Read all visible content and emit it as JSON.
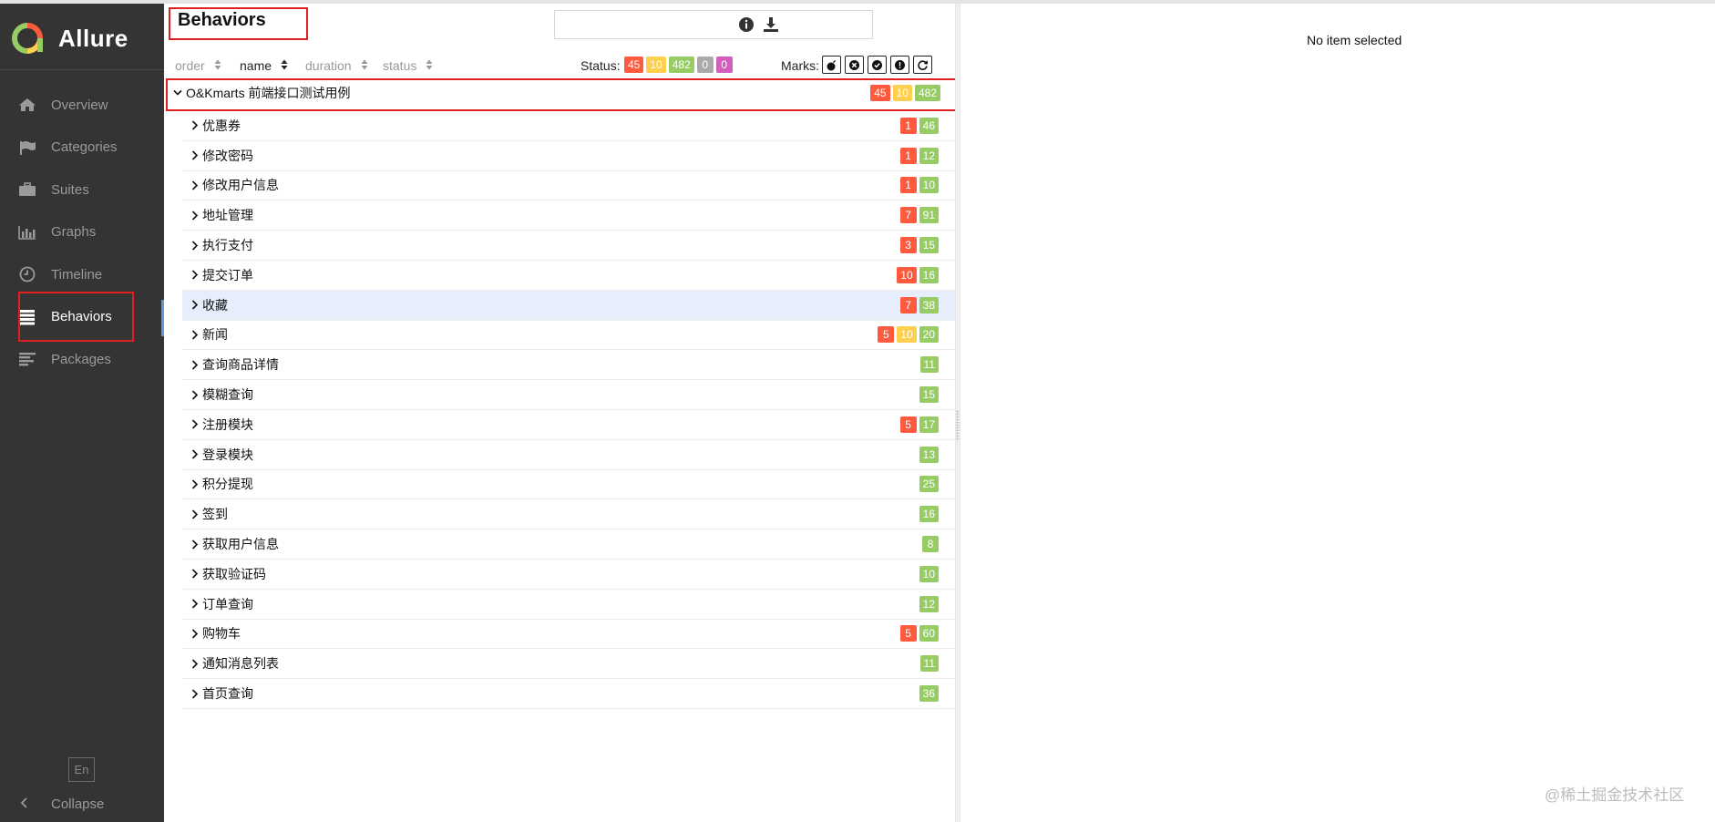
{
  "app": {
    "name": "Allure"
  },
  "sidebar": {
    "items": [
      {
        "label": "Overview",
        "icon": "home-icon"
      },
      {
        "label": "Categories",
        "icon": "flag-icon"
      },
      {
        "label": "Suites",
        "icon": "briefcase-icon"
      },
      {
        "label": "Graphs",
        "icon": "bar-chart-icon"
      },
      {
        "label": "Timeline",
        "icon": "clock-icon"
      },
      {
        "label": "Behaviors",
        "icon": "list-icon",
        "active": true
      },
      {
        "label": "Packages",
        "icon": "align-left-icon"
      }
    ],
    "language": "En",
    "collapse_label": "Collapse"
  },
  "main": {
    "title": "Behaviors",
    "search": {
      "value": "",
      "placeholder": ""
    },
    "sort": [
      {
        "label": "order",
        "active": false
      },
      {
        "label": "name",
        "active": true
      },
      {
        "label": "duration",
        "active": false
      },
      {
        "label": "status",
        "active": false
      }
    ],
    "status_label": "Status:",
    "status_filters": {
      "failed": "45",
      "broken": "10",
      "passed": "482",
      "skipped": "0",
      "unknown": "0"
    },
    "marks_label": "Marks:",
    "marks": [
      "flaky-icon",
      "new-failed-icon",
      "new-passed-icon",
      "new-broken-icon",
      "retries-icon"
    ],
    "root": {
      "name": "O&Kmarts 前端接口测试用例",
      "failed": "45",
      "broken": "10",
      "passed": "482"
    },
    "rows": [
      {
        "name": "优惠券",
        "failed": "1",
        "broken": "",
        "passed": "46"
      },
      {
        "name": "修改密码",
        "failed": "1",
        "broken": "",
        "passed": "12"
      },
      {
        "name": "修改用户信息",
        "failed": "1",
        "broken": "",
        "passed": "10"
      },
      {
        "name": "地址管理",
        "failed": "7",
        "broken": "",
        "passed": "91"
      },
      {
        "name": "执行支付",
        "failed": "3",
        "broken": "",
        "passed": "15"
      },
      {
        "name": "提交订单",
        "failed": "10",
        "broken": "",
        "passed": "16"
      },
      {
        "name": "收藏",
        "failed": "7",
        "broken": "",
        "passed": "38",
        "selected": true
      },
      {
        "name": "新闻",
        "failed": "5",
        "broken": "10",
        "passed": "20"
      },
      {
        "name": "查询商品详情",
        "failed": "",
        "broken": "",
        "passed": "11"
      },
      {
        "name": "模糊查询",
        "failed": "",
        "broken": "",
        "passed": "15"
      },
      {
        "name": "注册模块",
        "failed": "5",
        "broken": "",
        "passed": "17"
      },
      {
        "name": "登录模块",
        "failed": "",
        "broken": "",
        "passed": "13"
      },
      {
        "name": "积分提现",
        "failed": "",
        "broken": "",
        "passed": "25"
      },
      {
        "name": "签到",
        "failed": "",
        "broken": "",
        "passed": "16"
      },
      {
        "name": "获取用户信息",
        "failed": "",
        "broken": "",
        "passed": "8"
      },
      {
        "name": "获取验证码",
        "failed": "",
        "broken": "",
        "passed": "10"
      },
      {
        "name": "订单查询",
        "failed": "",
        "broken": "",
        "passed": "12"
      },
      {
        "name": "购物车",
        "failed": "5",
        "broken": "",
        "passed": "60"
      },
      {
        "name": "通知消息列表",
        "failed": "",
        "broken": "",
        "passed": "11"
      },
      {
        "name": "首页查询",
        "failed": "",
        "broken": "",
        "passed": "36"
      }
    ]
  },
  "detail": {
    "empty_text": "No item selected"
  },
  "watermark": "@稀土掘金技术社区",
  "colors": {
    "failed": "#fd5a3e",
    "broken": "#ffd050",
    "passed": "#97cc64",
    "skipped": "#aaaaaa",
    "unknown": "#d35ebe",
    "sidebar": "#343434"
  }
}
